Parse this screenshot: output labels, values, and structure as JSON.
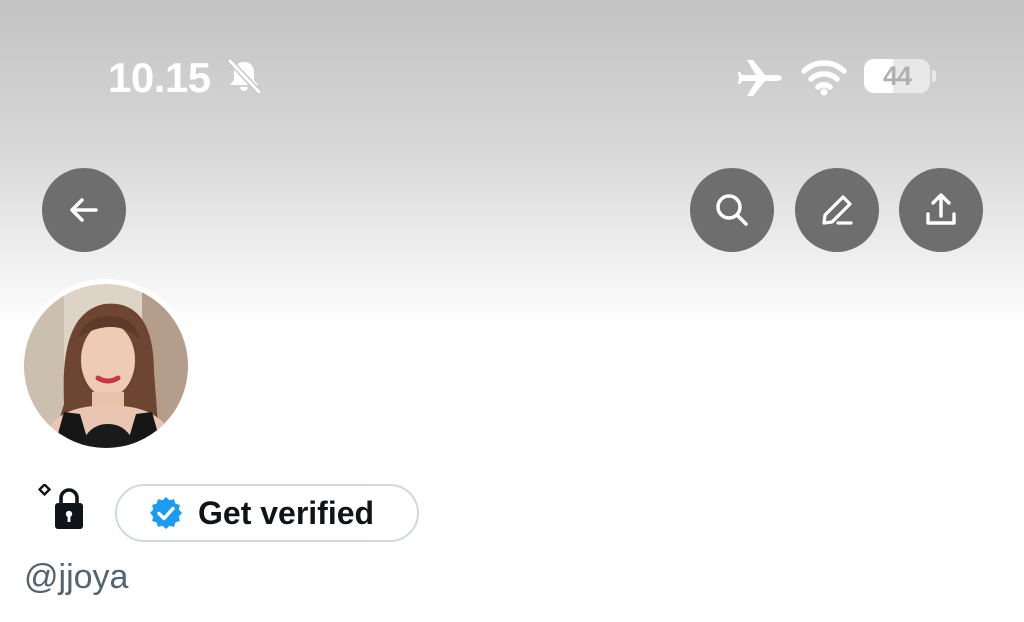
{
  "status_bar": {
    "time": "10.15",
    "battery_label": "44",
    "battery_level": 0.44,
    "icons": [
      "bell-slash-icon",
      "airplane-icon",
      "wifi-icon",
      "battery-icon"
    ]
  },
  "top_bar": {
    "icons": [
      "arrow-left-icon",
      "search-icon",
      "pencil-icon",
      "share-icon"
    ]
  },
  "profile": {
    "handle": "@jjoya",
    "get_verified_label": "Get verified",
    "icons": [
      "avatar",
      "lock-icon",
      "verified-badge-icon"
    ]
  },
  "colors": {
    "button_bg": "#6e6e6e",
    "verified_blue": "#1d9bf0",
    "handle_gray": "#536471",
    "pill_border": "#cfd9de"
  }
}
